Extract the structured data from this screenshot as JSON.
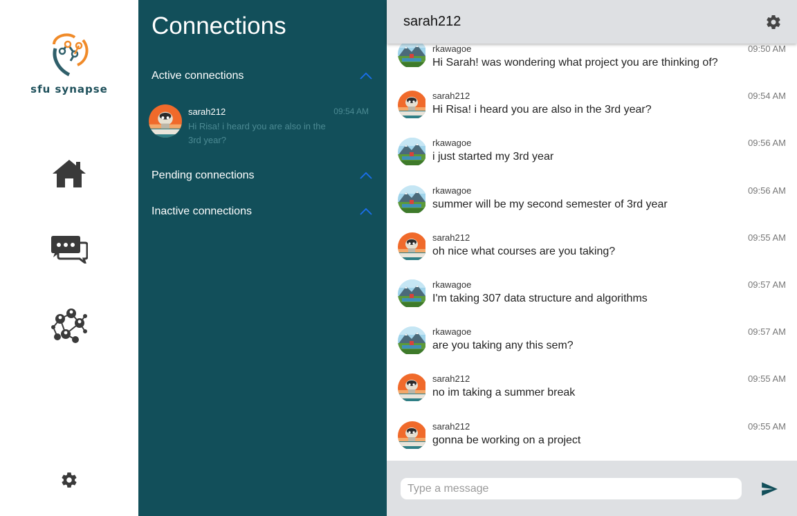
{
  "app": {
    "logo_text": "sfu synapse",
    "colors": {
      "panel": "#124f5a",
      "header": "#dee0e3",
      "accent": "#1a6ff0",
      "icon": "#3a3a3a"
    }
  },
  "nav": {
    "items": [
      {
        "icon": "home-icon"
      },
      {
        "icon": "chat-bubbles-icon"
      },
      {
        "icon": "network-icon"
      }
    ],
    "settings_icon": "gear-icon"
  },
  "connections": {
    "title": "Connections",
    "sections": [
      {
        "label": "Active connections",
        "expanded": true
      },
      {
        "label": "Pending connections",
        "expanded": true
      },
      {
        "label": "Inactive connections",
        "expanded": true
      }
    ],
    "active": [
      {
        "name": "sarah212",
        "time": "09:54 AM",
        "preview": "Hi Risa! i heard you are also in the 3rd year?",
        "avatar": "sheep-avatar"
      }
    ]
  },
  "chat": {
    "title": "sarah212",
    "settings_icon": "gear-icon",
    "messages": [
      {
        "user": "rkawagoe",
        "time": "09:50 AM",
        "text": "Hi Sarah! was wondering what project you are thinking of?",
        "avatar": "mountain-avatar"
      },
      {
        "user": "sarah212",
        "time": "09:54 AM",
        "text": "Hi Risa! i heard you are also in the 3rd year?",
        "avatar": "sheep-avatar"
      },
      {
        "user": "rkawagoe",
        "time": "09:56 AM",
        "text": "i just started my 3rd year",
        "avatar": "mountain-avatar"
      },
      {
        "user": "rkawagoe",
        "time": "09:56 AM",
        "text": "summer will be my second semester of 3rd year",
        "avatar": "mountain-avatar"
      },
      {
        "user": "sarah212",
        "time": "09:55 AM",
        "text": "oh nice what courses are you taking?",
        "avatar": "sheep-avatar"
      },
      {
        "user": "rkawagoe",
        "time": "09:57 AM",
        "text": "I'm taking 307 data structure and algorithms",
        "avatar": "mountain-avatar"
      },
      {
        "user": "rkawagoe",
        "time": "09:57 AM",
        "text": "are you taking any this sem?",
        "avatar": "mountain-avatar"
      },
      {
        "user": "sarah212",
        "time": "09:55 AM",
        "text": "no im taking a summer break",
        "avatar": "sheep-avatar"
      },
      {
        "user": "sarah212",
        "time": "09:55 AM",
        "text": "gonna be working on a project",
        "avatar": "sheep-avatar"
      }
    ],
    "composer": {
      "placeholder": "Type a message",
      "value": "",
      "send_icon": "send-icon"
    }
  }
}
